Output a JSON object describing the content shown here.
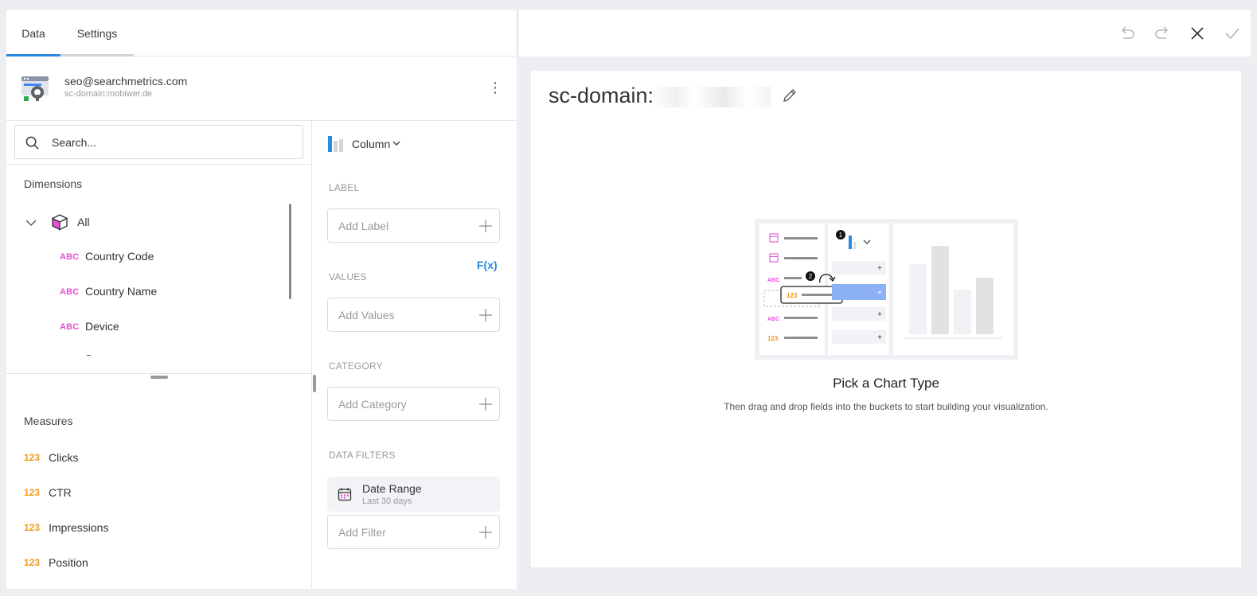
{
  "tabs": [
    {
      "label": "Data",
      "active": true
    },
    {
      "label": "Settings",
      "active": false
    }
  ],
  "colors": {
    "accent": "#2a8ae0",
    "abc": "#e84fd4",
    "number": "#f29a1e"
  },
  "datasource": {
    "email": "seo@searchmetrics.com",
    "domain": "sc-domain:mobiwer.de",
    "icon": "google-search-console-icon"
  },
  "search": {
    "placeholder": "Search..."
  },
  "dimensions": {
    "title": "Dimensions",
    "group": "All",
    "items": [
      {
        "type": "ABC",
        "label": "Country Code"
      },
      {
        "type": "ABC",
        "label": "Country Name"
      },
      {
        "type": "ABC",
        "label": "Device"
      }
    ]
  },
  "measures": {
    "title": "Measures",
    "items": [
      {
        "type": "123",
        "label": "Clicks"
      },
      {
        "type": "123",
        "label": "CTR"
      },
      {
        "type": "123",
        "label": "Impressions"
      },
      {
        "type": "123",
        "label": "Position"
      }
    ]
  },
  "config": {
    "chart_type": "Column",
    "label_section": "LABEL",
    "label_placeholder": "Add Label",
    "values_section": "VALUES",
    "fx": "F(x)",
    "values_placeholder": "Add Values",
    "category_section": "CATEGORY",
    "category_placeholder": "Add Category",
    "filters_section": "DATA FILTERS",
    "date_filter": {
      "label": "Date Range",
      "sub": "Last 30 days"
    },
    "filter_placeholder": "Add Filter"
  },
  "canvas": {
    "title": "sc-domain:",
    "pick_title": "Pick a Chart Type",
    "pick_subtitle": "Then drag and drop fields into the buckets to start building your visualization.",
    "illustration": {
      "step1": "1",
      "step2": "2",
      "abc": "ABC",
      "num": "123"
    }
  }
}
